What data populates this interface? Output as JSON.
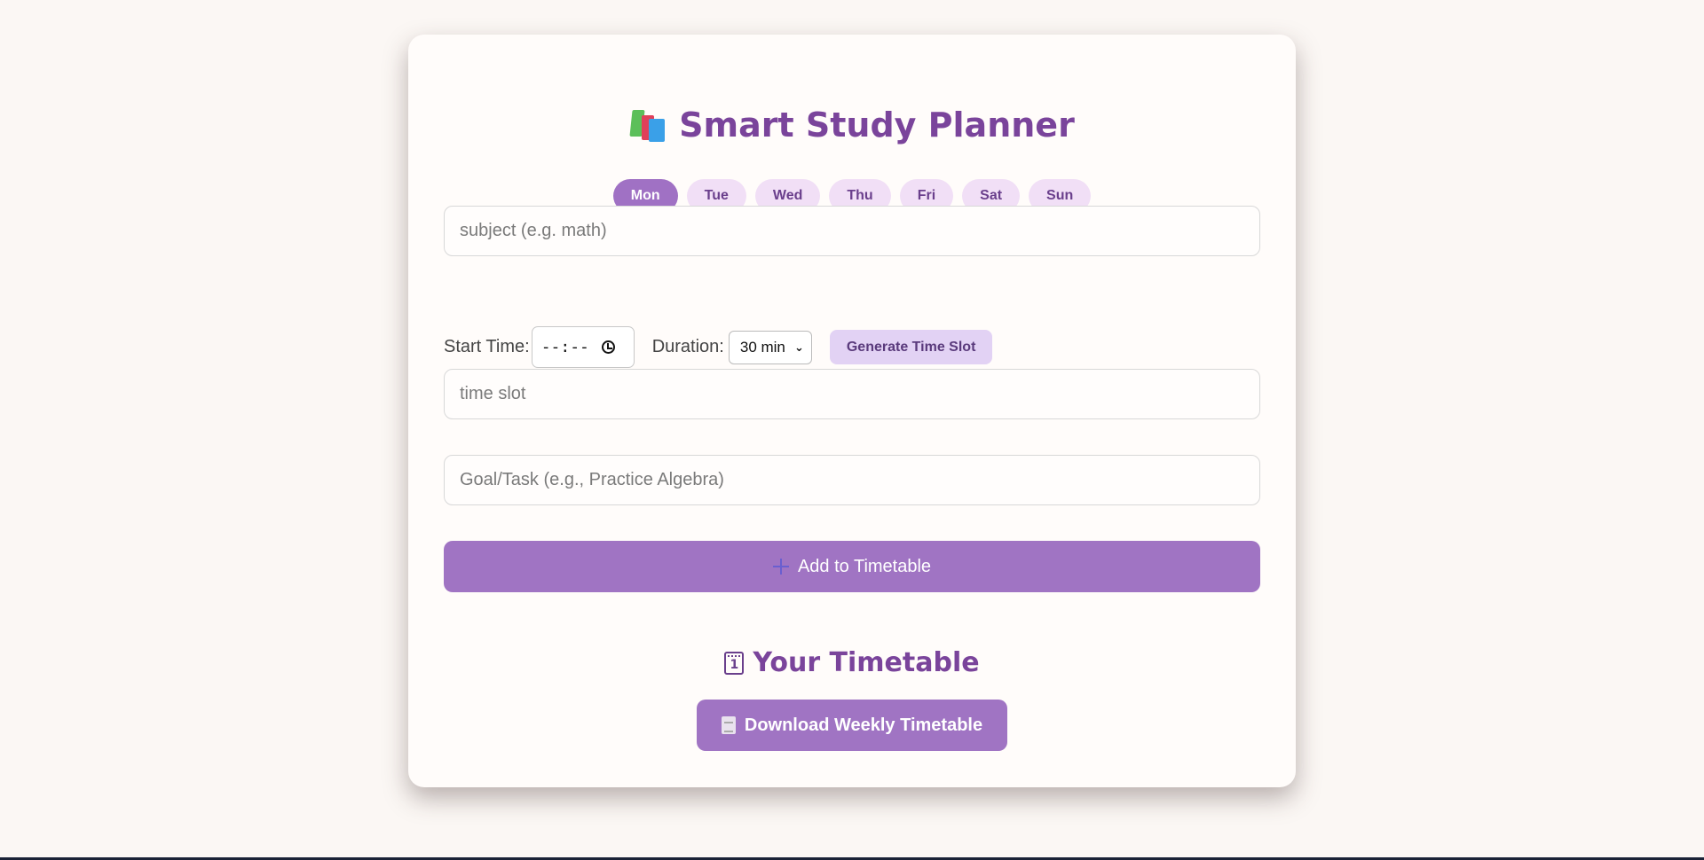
{
  "app": {
    "title": "Smart Study Planner",
    "title_icon": "books-icon"
  },
  "days": [
    "Mon",
    "Tue",
    "Wed",
    "Thu",
    "Fri",
    "Sat",
    "Sun"
  ],
  "selected_day": "Mon",
  "subject": {
    "placeholder": "subject (e.g. math)",
    "value": ""
  },
  "start_time": {
    "label": "Start Time:",
    "value": "--:--",
    "icon": "clock-icon"
  },
  "duration": {
    "label": "Duration:",
    "value": "30 min"
  },
  "generate_button": "Generate Time Slot",
  "time_slot": {
    "placeholder": "time slot",
    "value": ""
  },
  "goal": {
    "placeholder": "Goal/Task (e.g., Practice Algebra)",
    "value": ""
  },
  "add_button": {
    "label": "Add to Timetable",
    "icon": "plus-icon"
  },
  "timetable": {
    "title": "Your Timetable",
    "icon": "calendar-icon",
    "calendar_number": "1"
  },
  "download_button": {
    "label": "Download Weekly Timetable",
    "icon": "document-icon"
  },
  "colors": {
    "accent": "#a074c3",
    "title": "#7a449b",
    "day_pill": "#f1dff6",
    "background": "#fbf7f4"
  }
}
